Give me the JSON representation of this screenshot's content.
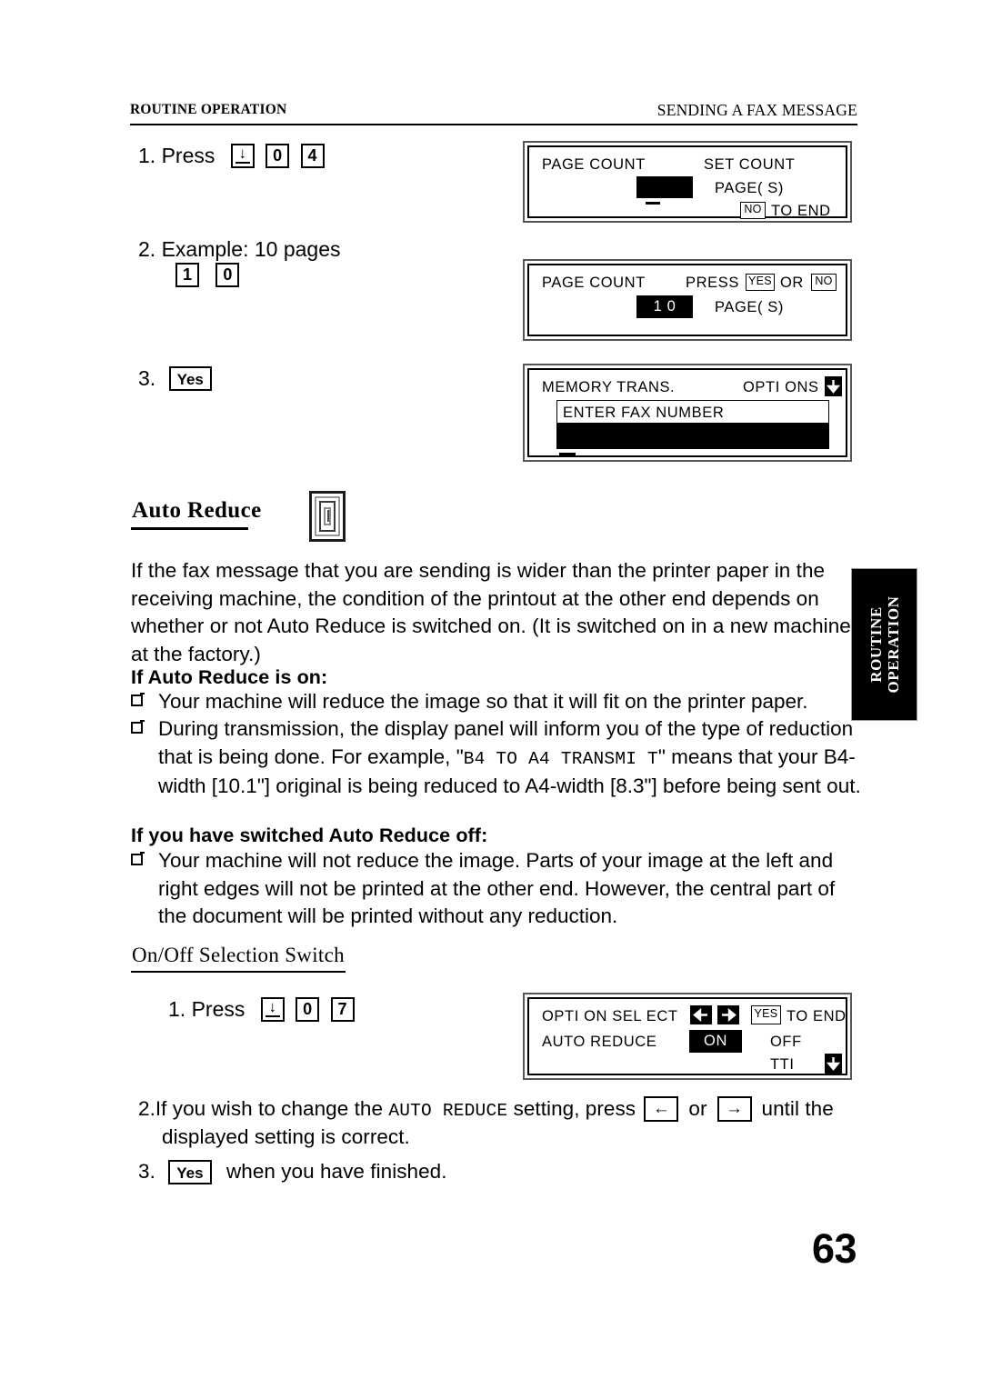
{
  "header": {
    "left": "ROUTINE OPERATION",
    "right": "SENDING A FAX MESSAGE"
  },
  "side_tab": {
    "line1": "ROUTINE",
    "line2": "OPERATION"
  },
  "page_number": "63",
  "steps_top": [
    {
      "number": "1.",
      "label": "Press",
      "keys": [
        "down-arrow",
        "0",
        "4"
      ]
    },
    {
      "number": "2.",
      "label": "Example: 10 pages",
      "keys": [
        "1",
        "0"
      ]
    },
    {
      "number": "3.",
      "label": "",
      "keys": [
        "Yes"
      ]
    }
  ],
  "keys": {
    "zero": "0",
    "one": "1",
    "four": "4",
    "seven": "7",
    "yes": "Yes",
    "no": "NO",
    "yes_small": "YES",
    "left_arrow": "←",
    "right_arrow": "→",
    "down_arrow": "↓"
  },
  "lcd_panels": [
    {
      "name": "page-count-empty",
      "title_left": "PAGE COUNT",
      "title_right": "SET COUNT",
      "field_value": "",
      "label_pages": "PAGE( S)",
      "key_hint_key": "NO",
      "key_hint_text": "TO END"
    },
    {
      "name": "page-count-10",
      "title_left": "PAGE COUNT",
      "prompt": "PRESS",
      "prompt_key1": "YES",
      "prompt_or": "OR",
      "prompt_key2": "NO",
      "field_value": "1 0",
      "label_pages": "PAGE( S)"
    },
    {
      "name": "memory-trans",
      "title_left": "MEMORY TRANS.",
      "title_right": "OPTI ONS",
      "scroll_icon": "down-arrow",
      "field_label": "ENTER FAX NUMBER",
      "field_value": ""
    },
    {
      "name": "option-select-auto-reduce",
      "title_left": "OPTI ON  SEL ECT",
      "arrow_left": "←",
      "arrow_right": "→",
      "yes_key": "YES",
      "to_end": "TO END",
      "row_label": "AUTO REDUCE",
      "option_on": "ON",
      "option_off": "OFF",
      "next_item": "TTI",
      "scroll_icon": "down-arrow"
    }
  ],
  "auto_reduce": {
    "heading": "Auto Reduce",
    "icon": "auto-reduce-switch-icon",
    "intro": "If the fax message that you are sending is wider than the printer paper in the receiving machine, the condition of the printout at the other end depends on whether or not Auto Reduce is switched on. (It is switched on in a new machine at the factory.)",
    "on_heading": "If Auto Reduce is on:",
    "on_bullets": [
      "Your machine will reduce the image so that it will fit on the printer paper.",
      "During transmission, the display panel will inform you of the type of reduction that is being done. For example, \"B4 TO A4 TRANSMI T\" means that your B4-width [10.1\"] original is being reduced to A4-width [8.3\"] before being sent out."
    ],
    "bullet2_pre": "During transmission, the display panel will inform you of the type of reduction that is being done. For example, \"",
    "bullet2_mono": "B4 TO A4 TRANSMI T",
    "bullet2_post": "\" means that your B4-width [10.1\"] original is being reduced to A4-width [8.3\"] before being sent out.",
    "off_heading": "If you have switched Auto Reduce off:",
    "off_bullets": [
      "Your machine will not reduce the image. Parts of your image at the left and right edges will not be printed at the other end. However, the central part of the document will be printed without any reduction."
    ]
  },
  "onoff": {
    "heading": "On/Off Selection Switch",
    "step1_number": "1.",
    "step1_label": "Press",
    "step1_keys": [
      "down-arrow",
      "0",
      "7"
    ],
    "step2_number": "2.",
    "step2_pre": "If you wish to change the ",
    "step2_mono": "AUTO REDUCE",
    "step2_mid": " setting, press ",
    "step2_or": "or",
    "step2_post": "until the",
    "step2_line2": "displayed setting is correct.",
    "step3_number": "3.",
    "step3_key": "Yes",
    "step3_text": "when you have finished."
  }
}
